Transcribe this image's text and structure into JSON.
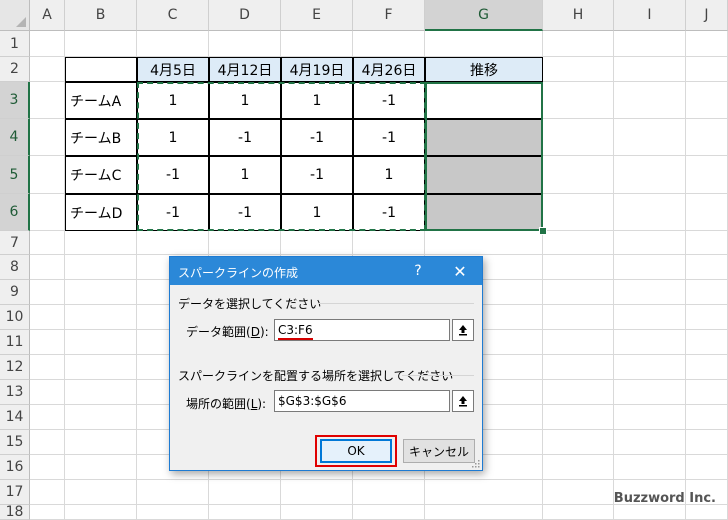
{
  "columns": [
    "A",
    "B",
    "C",
    "D",
    "E",
    "F",
    "G",
    "H",
    "I",
    "J"
  ],
  "rows": [
    "1",
    "2",
    "3",
    "4",
    "5",
    "6",
    "7",
    "8",
    "9",
    "10",
    "11",
    "12",
    "13",
    "14",
    "15",
    "16",
    "17",
    "18"
  ],
  "table": {
    "headers": [
      "4月5日",
      "4月12日",
      "4月19日",
      "4月26日",
      "推移"
    ],
    "teams": [
      {
        "name": "チームA",
        "values": [
          "1",
          "1",
          "1",
          "-1"
        ]
      },
      {
        "name": "チームB",
        "values": [
          "1",
          "-1",
          "-1",
          "-1"
        ]
      },
      {
        "name": "チームC",
        "values": [
          "-1",
          "1",
          "-1",
          "1"
        ]
      },
      {
        "name": "チームD",
        "values": [
          "-1",
          "-1",
          "1",
          "-1"
        ]
      }
    ]
  },
  "dialog": {
    "title": "スパークラインの作成",
    "help": "?",
    "close": "✕",
    "data_group": "データを選択してください",
    "data_range_label": "データ範囲(",
    "data_range_key": "D",
    "data_range_suffix": "):",
    "data_range_value": "C3:F6",
    "location_group": "スパークラインを配置する場所を選択してください",
    "location_label": "場所の範囲(",
    "location_key": "L",
    "location_suffix": "):",
    "location_value": "$G$3:$G$6",
    "ok": "OK",
    "cancel": "キャンセル"
  },
  "watermark": "Buzzword Inc.",
  "colors": {
    "header_fill": "#ddebf7",
    "selection_green": "#217346",
    "title_bar": "#2b88d8",
    "highlight_red": "#e00000",
    "gray_fill": "#c8c8c8"
  }
}
